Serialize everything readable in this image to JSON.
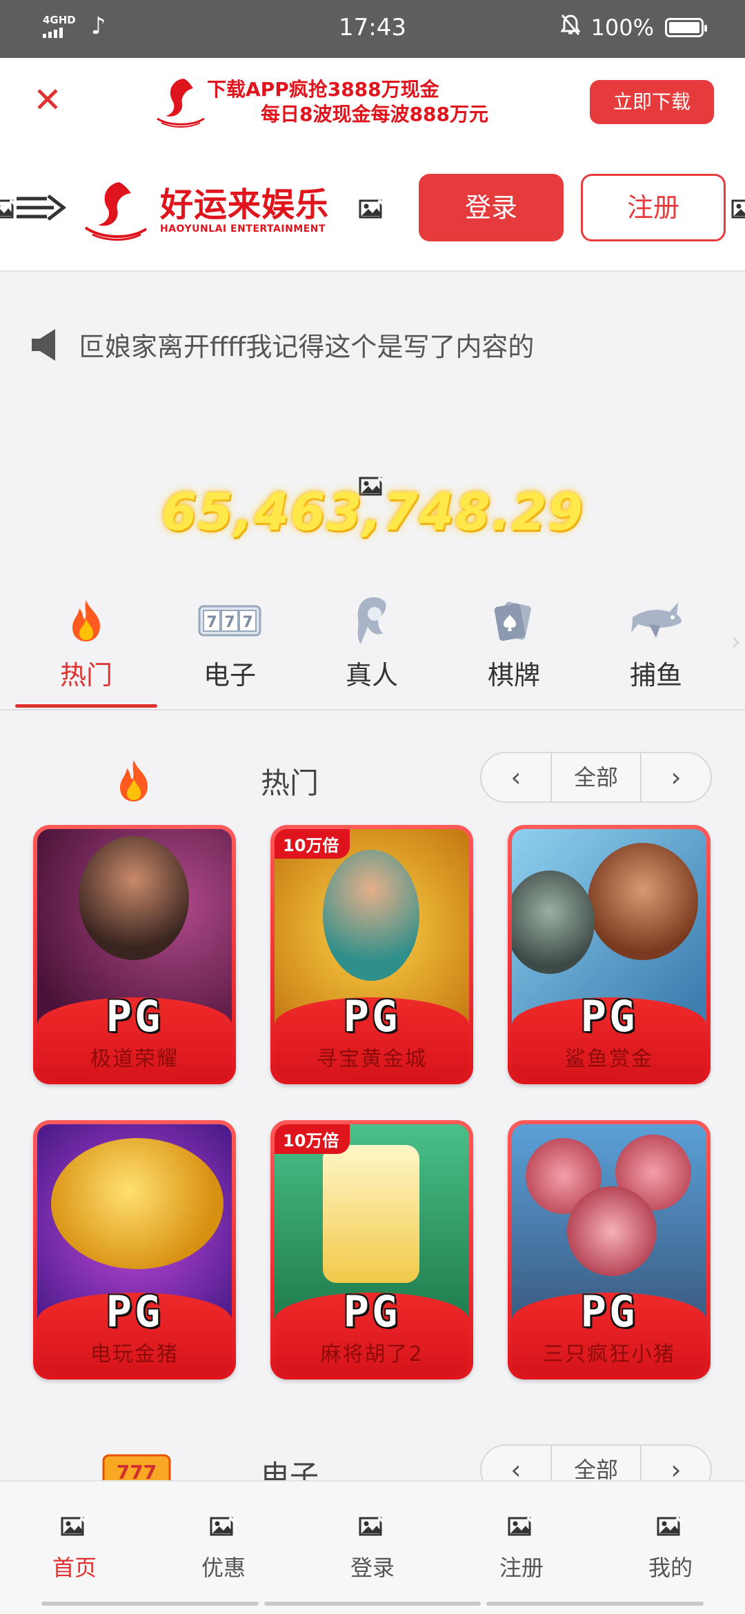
{
  "status_bar": {
    "network": "4GHD",
    "time": "17:43",
    "battery": "100%"
  },
  "download_banner": {
    "line1": "下载APP疯抢3888万现金",
    "line2": "每日8波现金每波888万元",
    "button": "立即下载"
  },
  "header": {
    "brand_cn": "好运来娱乐",
    "brand_en": "HAOYUNLAI ENTERTAINMENT",
    "login": "登录",
    "register": "注册"
  },
  "notice": {
    "text": "叵娘家离开ffff我记得这个是写了内容的"
  },
  "jackpot": {
    "amount": "65,463,748.29"
  },
  "category_tabs": [
    {
      "label": "热门",
      "icon": "fire-icon",
      "active": true
    },
    {
      "label": "电子",
      "icon": "slot-777-icon",
      "active": false
    },
    {
      "label": "真人",
      "icon": "dealer-icon",
      "active": false
    },
    {
      "label": "棋牌",
      "icon": "cards-icon",
      "active": false
    },
    {
      "label": "捕鱼",
      "icon": "shark-icon",
      "active": false
    }
  ],
  "hot_section": {
    "title": "热门",
    "all": "全部",
    "prev": "‹",
    "next": "›",
    "games": [
      {
        "name": "极道荣耀",
        "logo": "PG",
        "badge": ""
      },
      {
        "name": "寻宝黄金城",
        "logo": "PG",
        "badge": "10万倍"
      },
      {
        "name": "鲨鱼赏金",
        "logo": "PG",
        "badge": ""
      },
      {
        "name": "电玩金猪",
        "logo": "PG",
        "badge": ""
      },
      {
        "name": "麻将胡了2",
        "logo": "PG",
        "badge": "10万倍"
      },
      {
        "name": "三只疯狂小猪",
        "logo": "PG",
        "badge": ""
      }
    ]
  },
  "slots_section": {
    "title": "电子",
    "all": "全部",
    "prev": "‹",
    "next": "›"
  },
  "bottom_nav": [
    {
      "label": "首页",
      "active": true
    },
    {
      "label": "优惠",
      "active": false
    },
    {
      "label": "登录",
      "active": false
    },
    {
      "label": "注册",
      "active": false
    },
    {
      "label": "我的",
      "active": false
    }
  ],
  "colors": {
    "accent": "#e63b3c",
    "brand_red": "#e0141c",
    "jackpot_gold": "#ffe94a"
  }
}
